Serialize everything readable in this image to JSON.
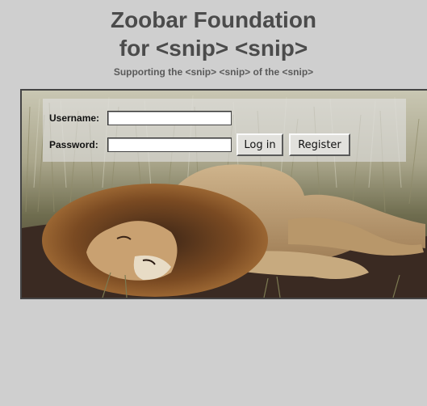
{
  "header": {
    "title_line1": "Zoobar Foundation",
    "title_line2": "for <snip> <snip>",
    "subtitle": "Supporting the <snip> <snip> of the <snip>"
  },
  "login": {
    "username_label": "Username:",
    "password_label": "Password:",
    "username_value": "",
    "password_value": "",
    "login_button": "Log in",
    "register_button": "Register"
  },
  "colors": {
    "background": "#cfcfcf",
    "title": "#4b4b4b"
  }
}
